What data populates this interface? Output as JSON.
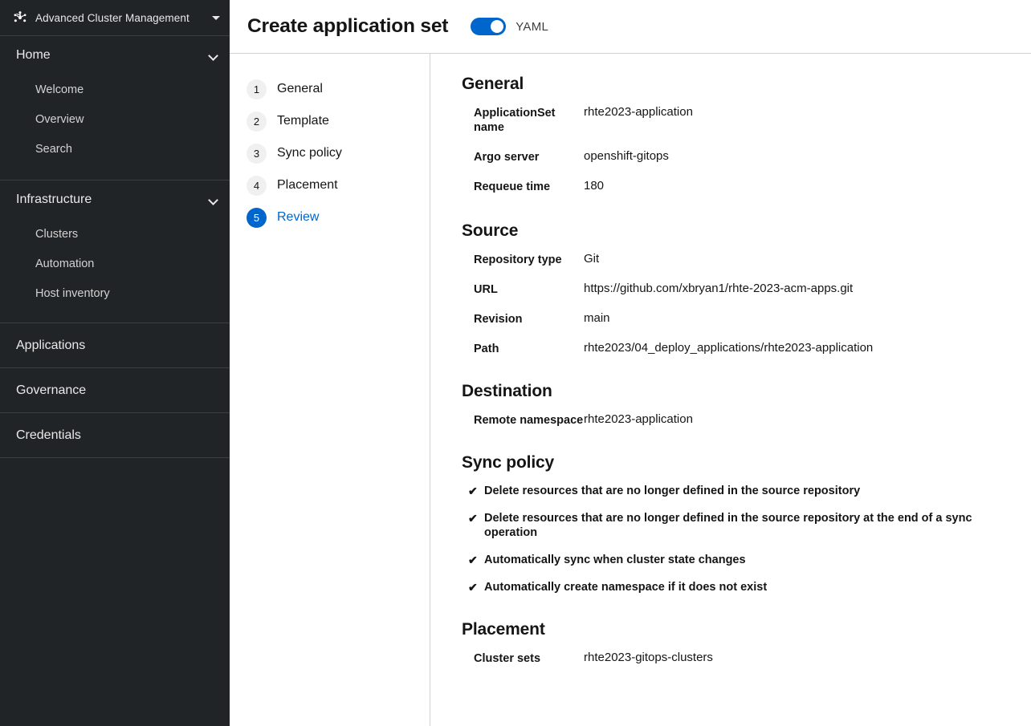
{
  "sidebar": {
    "masthead": {
      "logo_icon": "cluster-star-icon",
      "title": "Advanced Cluster Management",
      "caret_icon": "caret-down-icon"
    },
    "groups": [
      {
        "title": "Home",
        "chevron_icon": "chevron-down-icon",
        "items": [
          {
            "label": "Welcome"
          },
          {
            "label": "Overview"
          },
          {
            "label": "Search"
          }
        ]
      },
      {
        "title": "Infrastructure",
        "chevron_icon": "chevron-down-icon",
        "items": [
          {
            "label": "Clusters"
          },
          {
            "label": "Automation"
          },
          {
            "label": "Host inventory"
          }
        ]
      }
    ],
    "items": [
      {
        "label": "Applications"
      },
      {
        "label": "Governance"
      },
      {
        "label": "Credentials"
      }
    ]
  },
  "header": {
    "title": "Create application set",
    "yaml_label": "YAML",
    "yaml_toggle_on": true
  },
  "steps": [
    {
      "number": "1",
      "label": "General",
      "active": false
    },
    {
      "number": "2",
      "label": "Template",
      "active": false
    },
    {
      "number": "3",
      "label": "Sync policy",
      "active": false
    },
    {
      "number": "4",
      "label": "Placement",
      "active": false
    },
    {
      "number": "5",
      "label": "Review",
      "active": true
    }
  ],
  "review": {
    "general": {
      "title": "General",
      "rows": [
        {
          "label": "ApplicationSet name",
          "value": "rhte2023-application"
        },
        {
          "label": "Argo server",
          "value": "openshift-gitops"
        },
        {
          "label": "Requeue time",
          "value": "180"
        }
      ]
    },
    "source": {
      "title": "Source",
      "rows": [
        {
          "label": "Repository type",
          "value": "Git"
        },
        {
          "label": "URL",
          "value": "https://github.com/xbryan1/rhte-2023-acm-apps.git"
        },
        {
          "label": "Revision",
          "value": "main"
        },
        {
          "label": "Path",
          "value": "rhte2023/04_deploy_applications/rhte2023-application"
        }
      ]
    },
    "destination": {
      "title": "Destination",
      "rows": [
        {
          "label": "Remote namespace",
          "value": "rhte2023-application"
        }
      ]
    },
    "sync_policy": {
      "title": "Sync policy",
      "check_glyph": "✔",
      "items": [
        {
          "label": "Delete resources that are no longer defined in the source repository"
        },
        {
          "label": "Delete resources that are no longer defined in the source repository at the end of a sync operation"
        },
        {
          "label": "Automatically sync when cluster state changes"
        },
        {
          "label": "Automatically create namespace if it does not exist"
        }
      ]
    },
    "placement": {
      "title": "Placement",
      "rows": [
        {
          "label": "Cluster sets",
          "value": "rhte2023-gitops-clusters"
        }
      ]
    }
  },
  "colors": {
    "sidebar_bg": "#212427",
    "accent": "#0066cc",
    "text_dark": "#151515",
    "divider": "#d2d2d2"
  }
}
